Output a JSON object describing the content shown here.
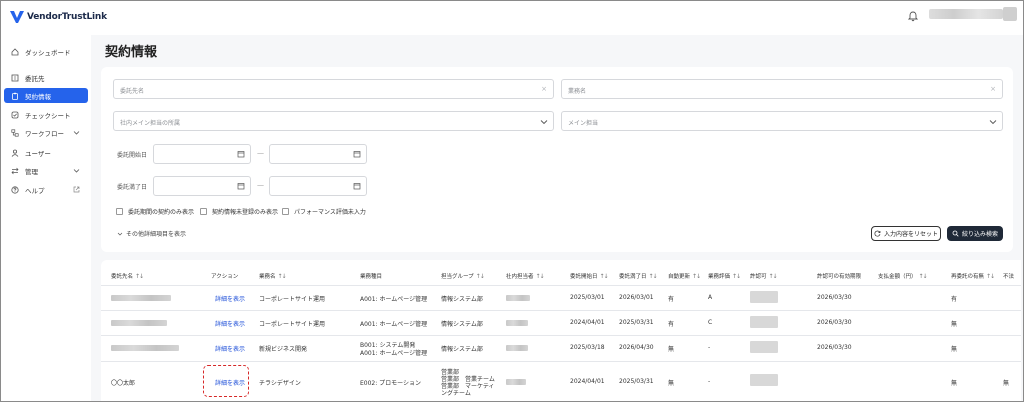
{
  "app": {
    "name": "VendorTrustLink"
  },
  "sidebar": {
    "items": [
      {
        "label": "ダッシュボード",
        "icon": "home-icon"
      },
      {
        "label": "委託先",
        "icon": "building-icon"
      },
      {
        "label": "契約情報",
        "icon": "clipboard-icon",
        "active": true
      },
      {
        "label": "チェックシート",
        "icon": "check-circle-icon"
      },
      {
        "label": "ワークフロー",
        "icon": "workflow-icon",
        "expandable": true
      },
      {
        "label": "ユーザー",
        "icon": "user-icon"
      },
      {
        "label": "管理",
        "icon": "swap-icon",
        "expandable": true
      },
      {
        "label": "ヘルプ",
        "icon": "help-icon",
        "external": true
      }
    ]
  },
  "page": {
    "title": "契約情報"
  },
  "filters": {
    "vendor_name_placeholder": "委託先名",
    "business_name_placeholder": "業務名",
    "department_placeholder": "社内メイン担当の所属",
    "owner_placeholder": "メイン担当",
    "start_label": "委託開始日",
    "end_label": "委託満了日",
    "range_separator": "—",
    "checkboxes": [
      "委託期間の契約のみ表示",
      "契約情報未登録のみ表示",
      "パフォーマンス評価未入力"
    ],
    "more_toggle": "その他詳細項目を表示",
    "reset_label": "入力内容をリセット",
    "search_label": "絞り込み検索"
  },
  "table": {
    "columns": [
      "委託先名",
      "アクション",
      "業務名",
      "業務種目",
      "担当グループ",
      "社内担当者",
      "委託開始日",
      "委託満了日",
      "自動更新",
      "業務評価",
      "許認可",
      "許認可の有効期限",
      "支払金額（円）",
      "再委託の有無",
      "不法"
    ],
    "rows": [
      {
        "vendor": "",
        "action": "詳細を表示",
        "business": "コーポレートサイト運用",
        "category": [
          "A001: ホームページ管理"
        ],
        "group": [
          "情報システム部"
        ],
        "start": "2025/03/01",
        "end": "2026/03/01",
        "auto_renew": "有",
        "rating": "A",
        "permit_expiry": "2026/03/30",
        "subcontract": "有",
        "illegal": ""
      },
      {
        "vendor": "",
        "action": "詳細を表示",
        "business": "コーポレートサイト運用",
        "category": [
          "A001: ホームページ管理"
        ],
        "group": [
          "情報システム部"
        ],
        "start": "2024/04/01",
        "end": "2025/03/31",
        "auto_renew": "有",
        "rating": "C",
        "permit_expiry": "2026/03/30",
        "subcontract": "無",
        "illegal": ""
      },
      {
        "vendor": "",
        "action": "詳細を表示",
        "business": "新規ビジネス開発",
        "category": [
          "B001: システム開発",
          "A001: ホームページ管理"
        ],
        "group": [
          "情報システム部"
        ],
        "start": "2025/03/18",
        "end": "2026/04/30",
        "auto_renew": "無",
        "rating": "-",
        "permit_expiry": "2026/03/30",
        "subcontract": "無",
        "illegal": ""
      },
      {
        "vendor": "〇〇太郎",
        "action": "詳細を表示",
        "business": "チラシデザイン",
        "category": [
          "E002: プロモーション"
        ],
        "group": [
          "営業部",
          "営業部　営業チーム",
          "営業部　マーケティ",
          "ングチーム"
        ],
        "start": "2024/04/01",
        "end": "2025/03/31",
        "auto_renew": "無",
        "rating": "-",
        "permit_expiry": "",
        "subcontract": "無",
        "illegal": "無"
      }
    ]
  },
  "colors": {
    "accent": "#2563eb",
    "dark_button": "#1f2937",
    "link": "#1d4ed8",
    "highlight": "#d62828"
  }
}
